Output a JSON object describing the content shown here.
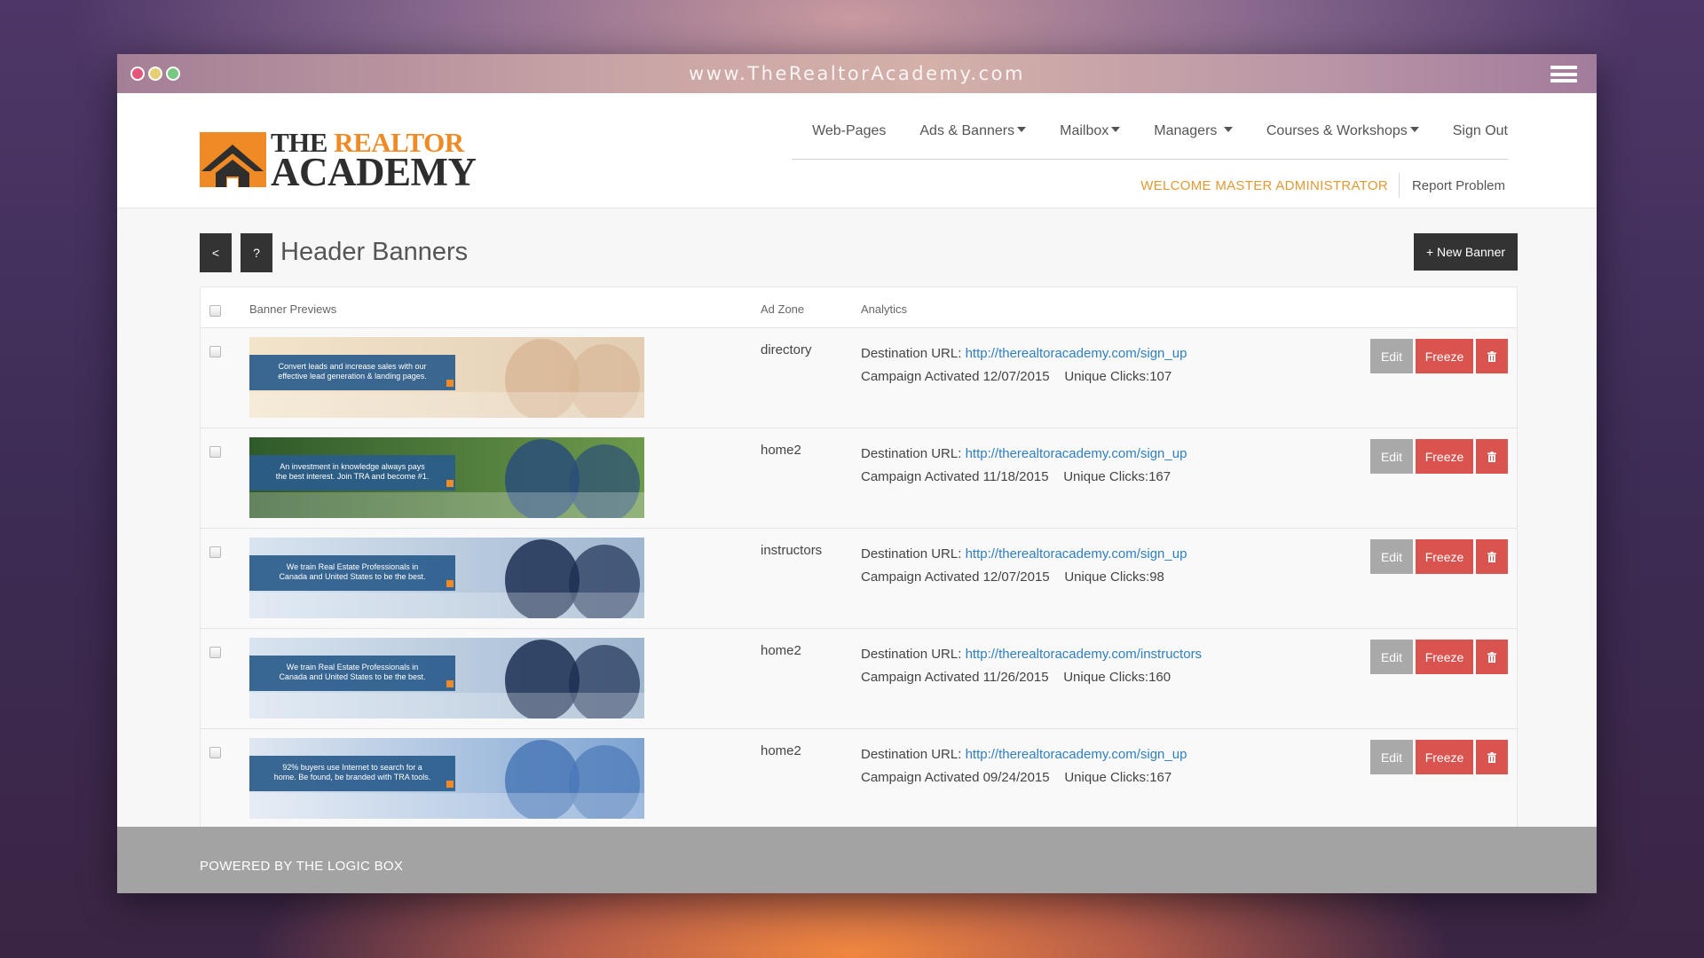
{
  "window": {
    "url": "www.TheRealtorAcademy.com",
    "colors": {
      "close": "#e5577a",
      "minimize": "#e8cf71",
      "maximize": "#78c883"
    }
  },
  "header": {
    "logo": {
      "line1_dark": "THE",
      "line1_orange": "REALTOR",
      "line2": "ACADEMY"
    },
    "nav": [
      {
        "label": "Web-Pages",
        "dropdown": false
      },
      {
        "label": "Ads & Banners",
        "dropdown": true
      },
      {
        "label": "Mailbox",
        "dropdown": true
      },
      {
        "label": "Managers",
        "dropdown": true
      },
      {
        "label": "Courses & Workshops",
        "dropdown": true
      },
      {
        "label": "Sign Out",
        "dropdown": false
      }
    ],
    "welcome": "WELCOME MASTER ADMINISTRATOR",
    "report": "Report Problem"
  },
  "toolbar": {
    "back_label": "<",
    "help_label": "?",
    "title": "Header Banners",
    "new_banner_label": "+ New Banner"
  },
  "table": {
    "headers": {
      "previews": "Banner Previews",
      "zone": "Ad Zone",
      "analytics": "Analytics"
    },
    "rows": [
      {
        "banner_text": [
          "Convert leads and increase sales with our",
          "effective lead generation & landing pages."
        ],
        "zone": "directory",
        "dest_label": "Destination URL:",
        "url": "http://therealtoracademy.com/sign_up",
        "campaign": "Campaign Activated 12/07/2015",
        "clicks": "Unique Clicks:107"
      },
      {
        "banner_text": [
          "An investment in knowledge always pays",
          "the best interest. Join TRA and become #1."
        ],
        "zone": "home2",
        "dest_label": "Destination URL:",
        "url": "http://therealtoracademy.com/sign_up",
        "campaign": "Campaign Activated 11/18/2015",
        "clicks": "Unique Clicks:167"
      },
      {
        "banner_text": [
          "We train Real Estate Professionals in",
          "Canada and United States to be the best."
        ],
        "zone": "instructors",
        "dest_label": "Destination URL:",
        "url": "http://therealtoracademy.com/sign_up",
        "campaign": "Campaign Activated 12/07/2015",
        "clicks": "Unique Clicks:98"
      },
      {
        "banner_text": [
          "We train Real Estate Professionals in",
          "Canada and United States to be the best."
        ],
        "zone": "home2",
        "dest_label": "Destination URL:",
        "url": "http://therealtoracademy.com/instructors",
        "campaign": "Campaign Activated 11/26/2015",
        "clicks": "Unique Clicks:160"
      },
      {
        "banner_text": [
          "92% buyers use Internet to search for a",
          "home. Be found, be branded with TRA tools."
        ],
        "zone": "home2",
        "dest_label": "Destination URL:",
        "url": "http://therealtoracademy.com/sign_up",
        "campaign": "Campaign Activated 09/24/2015",
        "clicks": "Unique Clicks:167"
      }
    ],
    "actions": {
      "edit": "Edit",
      "freeze": "Freeze",
      "delete_icon": "trash-icon"
    }
  },
  "footer": {
    "text": "POWERED BY THE LOGIC BOX"
  },
  "colors": {
    "accent_orange": "#ef8a24",
    "welcome": "#e09a33",
    "danger": "#d9534f",
    "link": "#2f7fc0",
    "dark_button": "#333333"
  }
}
